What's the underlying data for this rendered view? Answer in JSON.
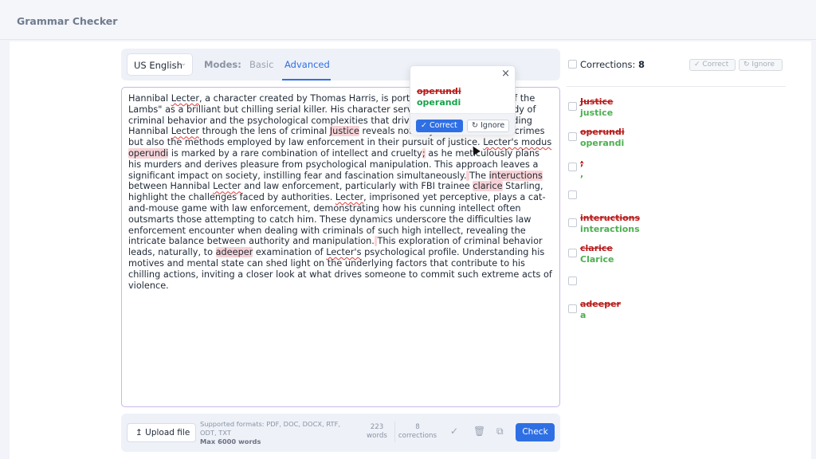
{
  "app": {
    "title": "Grammar Checker"
  },
  "toolbar": {
    "language": "US English",
    "modes_label": "Modes:",
    "tabs": [
      "Basic",
      "Advanced"
    ],
    "active_tab": "Advanced"
  },
  "editor": {
    "error_color": "#e23b3b",
    "highlight_color": "#f8d3d6"
  },
  "popup": {
    "original": "operundi",
    "suggestion": "operandi",
    "correct_label": "Correct",
    "ignore_label": "Ignore",
    "close_icon": "close-icon"
  },
  "footer": {
    "upload_label": "Upload file",
    "formats": "Supported formats: PDF, DOC, DOCX, RTF, ODT, TXT",
    "max_words": "Max 6000 words",
    "word_count": "223",
    "word_label": "words",
    "corrections_count": "8",
    "corrections_label": "corrections",
    "check_label": "Check"
  },
  "sidebar": {
    "title": "Corrections:",
    "count": "8",
    "correct_label": "Correct",
    "ignore_label": "Ignore",
    "items": [
      {
        "original": "Justice",
        "suggestion": "justice"
      },
      {
        "original": "operundi",
        "suggestion": "operandi"
      },
      {
        "original": ";",
        "suggestion": ","
      },
      {
        "original": "",
        "suggestion": ""
      },
      {
        "original": "inteructions",
        "suggestion": "interactions"
      },
      {
        "original": "clarice",
        "suggestion": "Clarice"
      },
      {
        "original": "",
        "suggestion": ""
      },
      {
        "original": "adeeper",
        "suggestion": "a"
      }
    ]
  },
  "colors": {
    "accent": "#2f6fe4",
    "error": "#b91c1c",
    "success": "#16a34a"
  }
}
